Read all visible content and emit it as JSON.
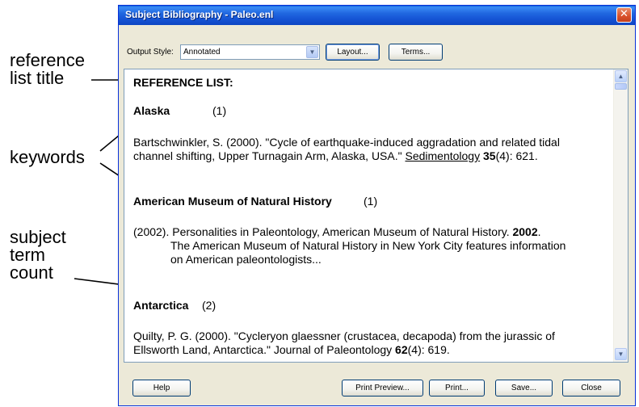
{
  "annotations": {
    "reference_list_title": [
      "reference",
      "list title"
    ],
    "keywords": "keywords",
    "subject_term_count": [
      "subject",
      "term",
      "count"
    ]
  },
  "window": {
    "title": "Subject Bibliography - Paleo.enl",
    "close_glyph": "✕"
  },
  "output_style": {
    "label": "Output Style:",
    "value": "Annotated",
    "arrow_glyph": "▼"
  },
  "buttons": {
    "layout": "Layout...",
    "terms": "Terms...",
    "help": "Help",
    "print_preview": "Print Preview...",
    "print": "Print...",
    "save": "Save...",
    "close": "Close"
  },
  "report": {
    "heading": "REFERENCE LIST:",
    "groups": [
      {
        "term": "Alaska",
        "count": "(1)",
        "entries": [
          {
            "line1": "Bartschwinkler, S. (2000). \"Cycle of earthquake-induced aggradation and related tidal",
            "line2_pre": "channel shifting, Upper Turnagain Arm, Alaska, USA.\" ",
            "journal": "Sedimentology",
            "volume": "35",
            "rest": "(4): 621."
          }
        ]
      },
      {
        "term": "American Museum of Natural History",
        "count": "(1)",
        "entries": [
          {
            "line1_pre": "(2002). Personalities in Paleontology, American Museum of Natural History. ",
            "year_bold": "2002",
            "line1_post": ".",
            "abstract1": "The American Museum of Natural History in New York City features information",
            "abstract2": "on American paleontologists..."
          }
        ]
      },
      {
        "term": "Antarctica",
        "count": "(2)",
        "entries": [
          {
            "line1": "Quilty, P. G. (2000). \"Cycleryon glaessner (crustacea, decapoda) from the jurassic of",
            "line2_pre": "Ellsworth Land, Antarctica.\" Journal of Paleontology ",
            "volume": "62",
            "rest": "(4): 619."
          }
        ]
      }
    ]
  },
  "scrollbar": {
    "up_glyph": "▲",
    "down_glyph": "▼"
  }
}
